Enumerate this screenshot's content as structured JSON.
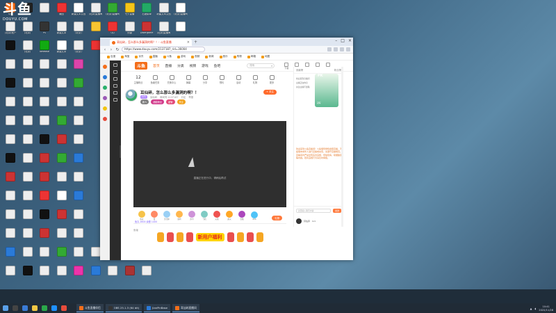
{
  "watermark": {
    "logo": "斗鱼",
    "domain": "DOUYU.COM"
  },
  "desktop": {
    "icons": [
      {
        "label": "斗鱼",
        "col": 0,
        "row": 0,
        "color": "#f46e1a"
      },
      {
        "label": "",
        "col": 1,
        "row": 0,
        "color": "#222"
      },
      {
        "label": "",
        "col": 2,
        "row": 0,
        "color": "#eee"
      },
      {
        "label": "撤回",
        "col": 3,
        "row": 0,
        "color": "#e33"
      },
      {
        "label": "新建文本文档",
        "col": 4,
        "row": 0,
        "color": "#fff"
      },
      {
        "label": "(北京)直播间",
        "col": 5,
        "row": 0,
        "color": "#eee"
      },
      {
        "label": "(北京)直播间",
        "col": 6,
        "row": 0,
        "color": "#3a3"
      },
      {
        "label": "七夕直播",
        "col": 7,
        "row": 0,
        "color": "#f5c518"
      },
      {
        "label": "右键菜单",
        "col": 8,
        "row": 0,
        "color": "#2a6"
      },
      {
        "label": "新建文本文档",
        "col": 9,
        "row": 0,
        "color": "#eee"
      },
      {
        "label": "(北京)直播间",
        "col": 10,
        "row": 0,
        "color": "#fff"
      },
      {
        "label": "(北京)账户",
        "col": 0,
        "row": 1,
        "color": "#eee"
      },
      {
        "label": "(北京)",
        "col": 1,
        "row": 1,
        "color": "#eee"
      },
      {
        "label": "PS",
        "col": 2,
        "row": 1,
        "color": "#333"
      },
      {
        "label": "新建文本",
        "col": 3,
        "row": 1,
        "color": "#eee"
      },
      {
        "label": "(北京)",
        "col": 4,
        "row": 1,
        "color": "#eee"
      },
      {
        "label": "",
        "col": 5,
        "row": 1,
        "color": "#f7c531"
      },
      {
        "label": "QQ",
        "col": 6,
        "row": 1,
        "color": "#e33"
      },
      {
        "label": "快捷",
        "col": 7,
        "row": 1,
        "color": "#eee"
      },
      {
        "label": "Lasergame",
        "col": 8,
        "row": 1,
        "color": "#c33"
      },
      {
        "label": "(北京)直播间",
        "col": 9,
        "row": 1,
        "color": "#eee"
      },
      {
        "label": "",
        "col": 10,
        "row": 1,
        "color": "#fff"
      },
      {
        "label": "",
        "col": 0,
        "row": 2,
        "color": "#111"
      },
      {
        "label": "(北京)",
        "col": 1,
        "row": 2,
        "color": "#eee"
      },
      {
        "label": "Netease",
        "col": 2,
        "row": 2,
        "color": "#1a1"
      },
      {
        "label": "新建文本",
        "col": 3,
        "row": 2,
        "color": "#fff"
      },
      {
        "label": "(北京)",
        "col": 4,
        "row": 2,
        "color": "#eee"
      },
      {
        "label": "",
        "col": 5,
        "row": 2,
        "color": "#e33"
      },
      {
        "label": "",
        "col": 0,
        "row": 3,
        "color": "#eee"
      },
      {
        "label": "",
        "col": 1,
        "row": 3,
        "color": "#eee"
      },
      {
        "label": "",
        "col": 2,
        "row": 3,
        "color": "#eee"
      },
      {
        "label": "",
        "col": 3,
        "row": 3,
        "color": "#eee"
      },
      {
        "label": "",
        "col": 4,
        "row": 3,
        "color": "#d4a"
      },
      {
        "label": "",
        "col": 0,
        "row": 4,
        "color": "#111"
      },
      {
        "label": "",
        "col": 1,
        "row": 4,
        "color": "#eee"
      },
      {
        "label": "",
        "col": 2,
        "row": 4,
        "color": "#eee"
      },
      {
        "label": "",
        "col": 3,
        "row": 4,
        "color": "#eee"
      },
      {
        "label": "",
        "col": 4,
        "row": 4,
        "color": "#3a3"
      },
      {
        "label": "",
        "col": 0,
        "row": 5,
        "color": "#eee"
      },
      {
        "label": "",
        "col": 1,
        "row": 5,
        "color": "#eee"
      },
      {
        "label": "",
        "col": 2,
        "row": 5,
        "color": "#eee"
      },
      {
        "label": "",
        "col": 3,
        "row": 5,
        "color": "#eee"
      },
      {
        "label": "",
        "col": 4,
        "row": 5,
        "color": "#eee"
      },
      {
        "label": "",
        "col": 0,
        "row": 6,
        "color": "#eee"
      },
      {
        "label": "",
        "col": 1,
        "row": 6,
        "color": "#eee"
      },
      {
        "label": "",
        "col": 2,
        "row": 6,
        "color": "#eee"
      },
      {
        "label": "",
        "col": 3,
        "row": 6,
        "color": "#3a3"
      },
      {
        "label": "",
        "col": 4,
        "row": 6,
        "color": "#eee"
      },
      {
        "label": "",
        "col": 0,
        "row": 7,
        "color": "#eee"
      },
      {
        "label": "",
        "col": 1,
        "row": 7,
        "color": "#eee"
      },
      {
        "label": "",
        "col": 2,
        "row": 7,
        "color": "#111"
      },
      {
        "label": "",
        "col": 3,
        "row": 7,
        "color": "#c33"
      },
      {
        "label": "",
        "col": 4,
        "row": 7,
        "color": "#eee"
      },
      {
        "label": "",
        "col": 0,
        "row": 8,
        "color": "#111"
      },
      {
        "label": "",
        "col": 1,
        "row": 8,
        "color": "#eee"
      },
      {
        "label": "",
        "col": 2,
        "row": 8,
        "color": "#c33"
      },
      {
        "label": "",
        "col": 3,
        "row": 8,
        "color": "#3a3"
      },
      {
        "label": "",
        "col": 4,
        "row": 8,
        "color": "#2a7ad8"
      },
      {
        "label": "",
        "col": 0,
        "row": 9,
        "color": "#c33"
      },
      {
        "label": "",
        "col": 1,
        "row": 9,
        "color": "#eee"
      },
      {
        "label": "",
        "col": 2,
        "row": 9,
        "color": "#c33"
      },
      {
        "label": "",
        "col": 3,
        "row": 9,
        "color": "#eee"
      },
      {
        "label": "",
        "col": 4,
        "row": 9,
        "color": "#eee"
      },
      {
        "label": "",
        "col": 0,
        "row": 10,
        "color": "#eee"
      },
      {
        "label": "",
        "col": 1,
        "row": 10,
        "color": "#eee"
      },
      {
        "label": "",
        "col": 2,
        "row": 10,
        "color": "#e33"
      },
      {
        "label": "",
        "col": 3,
        "row": 10,
        "color": "#fff"
      },
      {
        "label": "",
        "col": 4,
        "row": 10,
        "color": "#2a7ad8"
      },
      {
        "label": "",
        "col": 0,
        "row": 11,
        "color": "#eee"
      },
      {
        "label": "",
        "col": 1,
        "row": 11,
        "color": "#eee"
      },
      {
        "label": "",
        "col": 2,
        "row": 11,
        "color": "#111"
      },
      {
        "label": "",
        "col": 3,
        "row": 11,
        "color": "#c33"
      },
      {
        "label": "",
        "col": 4,
        "row": 11,
        "color": "#eee"
      },
      {
        "label": "",
        "col": 0,
        "row": 12,
        "color": "#eee"
      },
      {
        "label": "",
        "col": 1,
        "row": 12,
        "color": "#eee"
      },
      {
        "label": "",
        "col": 2,
        "row": 12,
        "color": "#c33"
      },
      {
        "label": "",
        "col": 3,
        "row": 12,
        "color": "#eee"
      },
      {
        "label": "",
        "col": 4,
        "row": 12,
        "color": "#eee"
      },
      {
        "label": "",
        "col": 0,
        "row": 13,
        "color": "#2a7ad8"
      },
      {
        "label": "",
        "col": 1,
        "row": 13,
        "color": "#eee"
      },
      {
        "label": "",
        "col": 2,
        "row": 13,
        "color": "#eee"
      },
      {
        "label": "",
        "col": 3,
        "row": 13,
        "color": "#3a3"
      },
      {
        "label": "",
        "col": 4,
        "row": 13,
        "color": "#eee"
      },
      {
        "label": "",
        "col": 5,
        "row": 13,
        "color": "#eee"
      },
      {
        "label": "",
        "col": 6,
        "row": 13,
        "color": "#eee"
      },
      {
        "label": "",
        "col": 7,
        "row": 13,
        "color": "#eee"
      },
      {
        "label": "",
        "col": 8,
        "row": 13,
        "color": "#fff"
      },
      {
        "label": "",
        "col": 0,
        "row": 14,
        "color": "#eee"
      },
      {
        "label": "",
        "col": 1,
        "row": 14,
        "color": "#111"
      },
      {
        "label": "",
        "col": 2,
        "row": 14,
        "color": "#eee"
      },
      {
        "label": "",
        "col": 3,
        "row": 14,
        "color": "#eee"
      },
      {
        "label": "",
        "col": 4,
        "row": 14,
        "color": "#e3a"
      },
      {
        "label": "",
        "col": 5,
        "row": 14,
        "color": "#2a7ad8"
      },
      {
        "label": "",
        "col": 6,
        "row": 14,
        "color": "#eee"
      },
      {
        "label": "",
        "col": 7,
        "row": 14,
        "color": "#a33"
      },
      {
        "label": "",
        "col": 8,
        "row": 14,
        "color": "#eee"
      }
    ]
  },
  "browser": {
    "tab_title": "耳仙碎，怎么那么多漏洞的啊？！- 斗鱼直播",
    "url": "https://www.douyu.com/2137187_rid=36004",
    "bookmarks": [
      "百度",
      "淘宝",
      "京东",
      "直播",
      "斗鱼",
      "游戏",
      "视频",
      "新闻",
      "音乐",
      "购物",
      "邮箱",
      "地图"
    ]
  },
  "site": {
    "logo": "斗鱼",
    "nav": [
      "首页",
      "直播",
      "分类",
      "视频",
      "游戏",
      "鱼吧"
    ],
    "search_placeholder": "搜索",
    "header_icons": [
      "下载",
      "历史",
      "关注",
      "消息",
      "开播"
    ],
    "actions": [
      {
        "label": "主播粉丝",
        "num": "12"
      },
      {
        "label": "鱼塘任务",
        "num": ""
      },
      {
        "label": "兑换中心",
        "num": ""
      },
      {
        "label": "弹幕",
        "num": ""
      },
      {
        "label": "分享",
        "num": ""
      },
      {
        "label": "预约",
        "num": ""
      },
      {
        "label": "活动",
        "num": ""
      },
      {
        "label": "礼物",
        "num": ""
      },
      {
        "label": "更多",
        "num": ""
      }
    ],
    "room_title": "耳仙碎，怎么那么多漏洞的啊？！",
    "level": "LV1",
    "streamer": "耳仙碎",
    "meta": [
      "房间号 2137187",
      "分区",
      "举报"
    ],
    "badges": [
      {
        "text": "新人",
        "color": "#7f7f7f"
      },
      {
        "text": "超能粉丝",
        "color": "#d23a8b"
      },
      {
        "text": "超管",
        "color": "#e34a7a"
      },
      {
        "text": "关注",
        "color": "#f2a21d"
      }
    ],
    "follow_label": "+ 关注",
    "player_message": "直播正在进行中，请稍后再试",
    "gifts": [
      "鱼丸",
      "赞",
      "荧光棒",
      "弱鸡",
      "办卡",
      "飞机",
      "火箭",
      "超火",
      "宝箱",
      "666"
    ],
    "gift_button": "礼物",
    "gift_info": "鱼丸 2600 余额 1400",
    "below_label": "鱼塘",
    "promo_text": "新用户福利"
  },
  "chat": {
    "top_left": "贡献榜",
    "top_right": "粉丝榜",
    "rank_tag": "PK",
    "rank_sub": "冠军",
    "lines": [
      "欢迎来到直播间",
      "主播正在休息",
      "关注主播不迷路"
    ],
    "notice": "欢迎来到斗鱼直播间！斗鱼倡导绿色健康直播，不提倡未成年人进行直播或充值，请遵守直播规范。直播间内严禁出现违法违规、低俗色情、吸烟酗酒等内容。若有违规行为请及时举报。",
    "input_placeholder": "这里输入聊天内容",
    "send_label": "发送",
    "me_name": "耳仙碎",
    "me_level": "LV1"
  },
  "taskbar": {
    "apps": [
      {
        "label": "斗鱼直播伴侣",
        "color": "#f46e1a"
      },
      {
        "label": "OBS 25.1.3 (64 bit)",
        "color": "#333"
      },
      {
        "label": "JianPinBase",
        "color": "#2a7ad8"
      },
      {
        "label": "耳仙碎直播间",
        "color": "#f46e1a"
      }
    ],
    "time": "10:41",
    "date": "2022/11/28"
  }
}
